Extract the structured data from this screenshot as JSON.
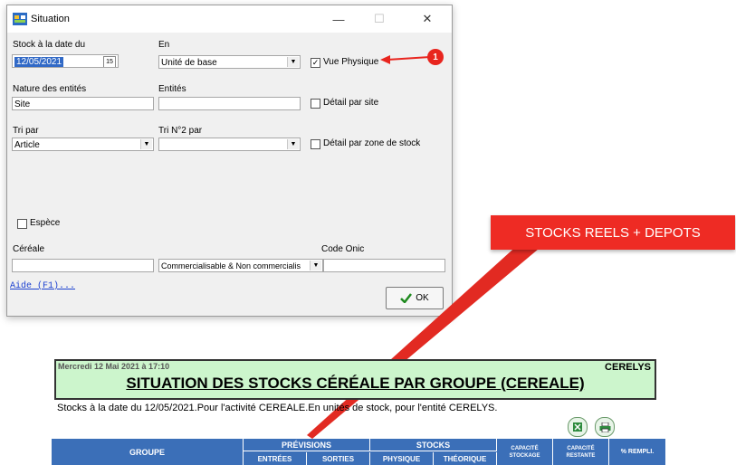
{
  "window": {
    "title": "Situation",
    "minimize": "—",
    "maximize": "☐",
    "close": "✕"
  },
  "form": {
    "stock_date_label": "Stock à la date du",
    "stock_date_value": "12/05/2021",
    "calendar_glyph": "15",
    "en_label": "En",
    "en_value": "Unité de base",
    "vue_physique_label": "Vue Physique",
    "vue_physique_checked": true,
    "nature_label": "Nature des entités",
    "nature_value": "Site",
    "entites_label": "Entités",
    "entites_value": "",
    "detail_site_label": "Détail par site",
    "tri_label": "Tri par",
    "tri_value": "Article",
    "tri2_label": "Tri N°2 par",
    "tri2_value": "",
    "detail_zone_label": "Détail par zone de stock",
    "espece_label": "Espèce",
    "cereale_label": "Céréale",
    "cereale_value": "",
    "commercial_value": "Commercialisable & Non commercialis",
    "code_onic_label": "Code Onic",
    "code_onic_value": "",
    "help_link": "Aide (F1)...",
    "ok_label": "OK"
  },
  "annotation": {
    "marker_number": "1",
    "callout_text": "STOCKS REELS + DEPOTS",
    "colors": {
      "red": "#e8251e",
      "callout_bg": "#ee2b24"
    }
  },
  "report": {
    "timestamp": "Mercredi 12 Mai 2021 à 17:10",
    "company": "CERELYS",
    "title": "SITUATION DES STOCKS CÉRÉALE PAR GROUPE (CEREALE)",
    "subtitle": "Stocks à la date du 12/05/2021.Pour l'activité CEREALE.En unités de stock, pour l'entité CERELYS.",
    "columns": {
      "groupe": "GROUPE",
      "previsions": "PRÉVISIONS",
      "entrees": "ENTRÉES",
      "sorties": "SORTIES",
      "stocks": "STOCKS",
      "physique": "PHYSIQUE",
      "theorique": "THÉORIQUE",
      "capacite_stockage": "CAPACITÉ STOCKAGE",
      "capacite_restante": "CAPACITÉ RESTANTE",
      "pct_rempli": "% REMPLI."
    },
    "colors": {
      "header_bg": "#ccf5cc",
      "table_head": "#3b6fb8"
    }
  }
}
